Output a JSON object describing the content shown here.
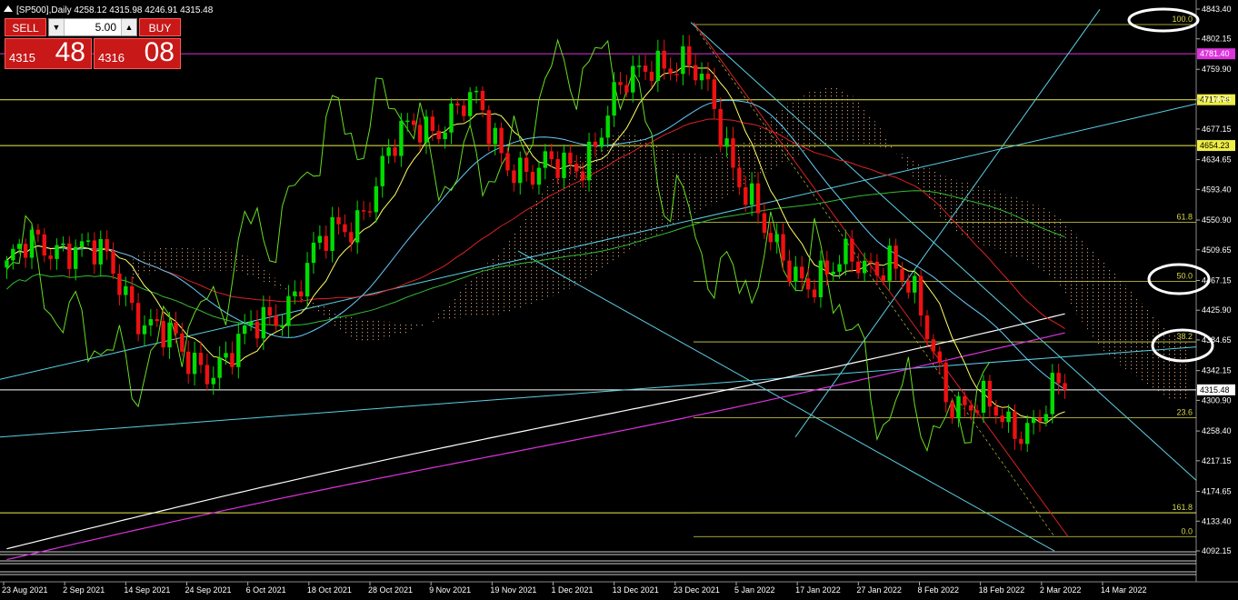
{
  "header": {
    "title": "[SP500],Daily  4258.12 4315.98 4246.91 4315.48"
  },
  "trade_panel": {
    "sell_label": "SELL",
    "buy_label": "BUY",
    "lot": "5.00",
    "sell_price_small": "4315",
    "sell_price_big": "48",
    "buy_price_small": "4316",
    "buy_price_big": "08"
  },
  "price_axis": {
    "labels": [
      "4843.40",
      "4802.15",
      "4759.90",
      "4718.65",
      "4677.15",
      "4634.65",
      "4593.40",
      "4550.90",
      "4509.65",
      "4467.15",
      "4425.90",
      "4384.65",
      "4342.15",
      "4300.90",
      "4258.40",
      "4217.15",
      "4174.65",
      "4133.40",
      "4092.15"
    ],
    "ymin": 4092.15,
    "ymax": 4843.4
  },
  "time_axis": {
    "labels": [
      "23 Aug 2021",
      "2 Sep 2021",
      "14 Sep 2021",
      "24 Sep 2021",
      "6 Oct 2021",
      "18 Oct 2021",
      "28 Oct 2021",
      "9 Nov 2021",
      "19 Nov 2021",
      "1 Dec 2021",
      "13 Dec 2021",
      "23 Dec 2021",
      "5 Jan 2022",
      "17 Jan 2022",
      "27 Jan 2022",
      "8 Feb 2022",
      "18 Feb 2022",
      "2 Mar 2022",
      "14 Mar 2022"
    ]
  },
  "levels": {
    "magenta_level": "4781.40",
    "yellow_level_1": "4717.74",
    "yellow_level_2": "4654.23",
    "current_price": "4315.48"
  },
  "fib": {
    "labels": [
      "100.0",
      "61.8",
      "50.0",
      "38.2",
      "23.6",
      "161.8",
      "0.0"
    ],
    "prices": [
      4822,
      4548,
      4466,
      4382,
      4277,
      4145,
      4112
    ]
  },
  "colors": {
    "bull": "#00dd00",
    "bear": "#ee1111",
    "tenkan": "#ffff66",
    "kijun": "#66ccff",
    "chikou": "#66dd22",
    "ma_red": "#dd2222",
    "ma_green": "#33bb33",
    "ma_white": "#ffffff",
    "ma_magenta": "#dd33dd",
    "trend_cyan": "#5ad0e6",
    "fib_line": "#d8d84a",
    "cloud_dots": "#d49a6a"
  },
  "chart_data": {
    "type": "line",
    "title": "",
    "xlabel": "",
    "ylabel": "",
    "ylim": [
      4092.15,
      4843.4
    ],
    "x": [
      "23 Aug 2021",
      "2 Sep 2021",
      "14 Sep 2021",
      "24 Sep 2021",
      "6 Oct 2021",
      "18 Oct 2021",
      "28 Oct 2021",
      "9 Nov 2021",
      "19 Nov 2021",
      "1 Dec 2021",
      "13 Dec 2021",
      "23 Dec 2021",
      "5 Jan 2022",
      "17 Jan 2022",
      "27 Jan 2022",
      "8 Feb 2022",
      "18 Feb 2022",
      "2 Mar 2022",
      "14 Mar 2022"
    ],
    "series": [
      {
        "values": [
          4486,
          4530,
          4460,
          4350,
          4370,
          4470,
          4570,
          4690,
          4700,
          4600,
          4660,
          4790,
          4720,
          4500,
          4470,
          4510,
          4320,
          4260,
          4315
        ]
      }
    ]
  }
}
